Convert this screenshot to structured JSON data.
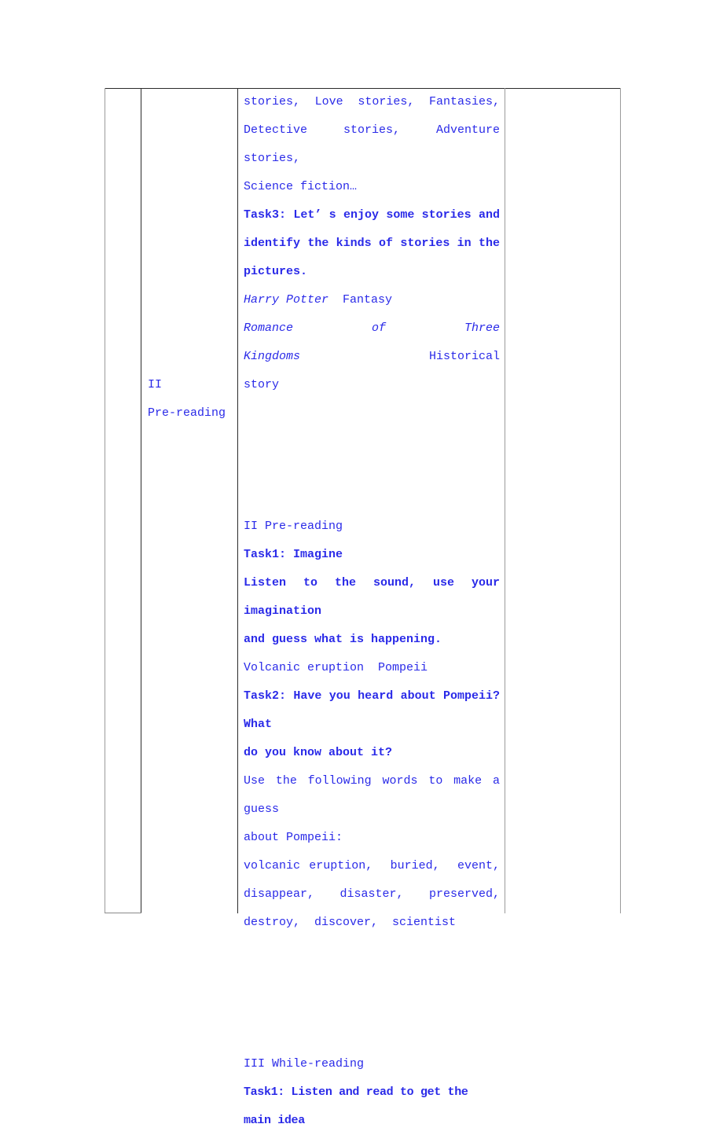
{
  "document": {
    "type": "lesson-plan-table",
    "text_color": "#2a2ae8",
    "border_color": "#2b2b2b"
  },
  "columns": {
    "stage": {
      "entries": [
        {
          "numeral": "II",
          "name": "Pre-reading"
        }
      ]
    }
  },
  "body": {
    "lines": [
      {
        "id": "l1",
        "text": "stories,  Love  stories,  Fantasies,"
      },
      {
        "id": "l2",
        "text": "Detective stories, Adventure stories,"
      },
      {
        "id": "l3",
        "text": "Science fiction…"
      },
      {
        "id": "l4",
        "text": "Task3: Let’ s enjoy some stories and"
      },
      {
        "id": "l5",
        "text": "identify the kinds of stories in the"
      },
      {
        "id": "l6",
        "text": "pictures."
      },
      {
        "id": "l7a",
        "text": "Harry Potter"
      },
      {
        "id": "l7b",
        "text": "Fantasy"
      },
      {
        "id": "l8a",
        "text": "Romance of Three Kingdoms"
      },
      {
        "id": "l8b",
        "text": "Historical"
      },
      {
        "id": "l9",
        "text": "story"
      },
      {
        "id": "l10",
        "text": "II Pre-reading"
      },
      {
        "id": "l11",
        "text": "Task1: Imagine"
      },
      {
        "id": "l12",
        "text": "Listen to the sound, use your imagination"
      },
      {
        "id": "l13",
        "text": "and guess what is happening."
      },
      {
        "id": "l14",
        "text": "Volcanic eruption  Pompeii"
      },
      {
        "id": "l15",
        "text": "Task2: Have you heard about Pompeii? What"
      },
      {
        "id": "l16",
        "text": "do you know about it?"
      },
      {
        "id": "l17",
        "text": "Use the following words to make a guess"
      },
      {
        "id": "l18",
        "text": "about Pompeii:"
      },
      {
        "id": "l19",
        "text": "volcanic eruption,  buried,  event,"
      },
      {
        "id": "l20",
        "text": "disappear,  disaster,  preserved,"
      },
      {
        "id": "l21",
        "text": "destroy,  discover,  scientist"
      },
      {
        "id": "l22",
        "text": "III While-reading"
      },
      {
        "id": "l23",
        "text": "Task1: Listen and read to get the main idea"
      }
    ]
  }
}
